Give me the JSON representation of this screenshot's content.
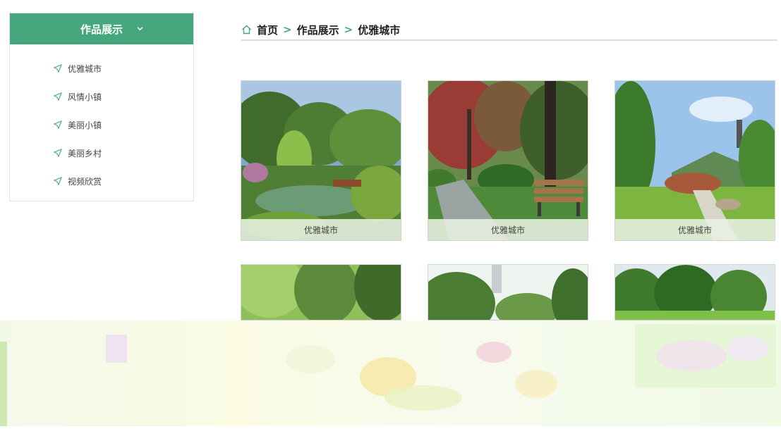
{
  "sidebar": {
    "title": "作品展示",
    "items": [
      {
        "label": "优雅城市"
      },
      {
        "label": "风情小镇"
      },
      {
        "label": "美丽小镇"
      },
      {
        "label": "美丽乡村"
      },
      {
        "label": "视频欣赏"
      }
    ]
  },
  "breadcrumb": {
    "items": [
      "首页",
      "作品展示",
      "优雅城市"
    ],
    "separator": ">"
  },
  "gallery": {
    "items": [
      {
        "caption": "优雅城市"
      },
      {
        "caption": "优雅城市"
      },
      {
        "caption": "优雅城市"
      },
      {
        "caption": ""
      },
      {
        "caption": ""
      },
      {
        "caption": ""
      }
    ]
  },
  "colors": {
    "accent": "#46a77f",
    "caption_bg": "#e8f0e1"
  },
  "icons": {
    "home": "home-icon",
    "side_item": "send-arrow-icon",
    "dropdown": "chevron-down-icon"
  }
}
